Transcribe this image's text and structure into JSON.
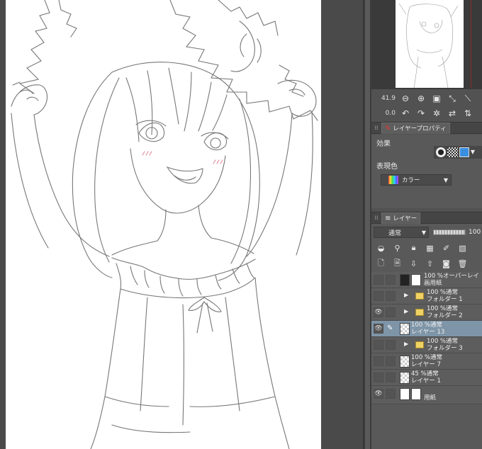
{
  "navigator": {
    "zoom": "41.9",
    "rotation": "0.0"
  },
  "layer_property_panel": {
    "tab_label": "レイヤープロパティ",
    "effect_label": "効果",
    "expression_color_label": "表現色",
    "expression_color_value": "カラー"
  },
  "layer_panel": {
    "tab_label": "レイヤー",
    "blend_mode": "通常",
    "opacity": "100",
    "layers": [
      {
        "line1": "100 %オーバーレイ",
        "line2": "画用紙",
        "type": "image",
        "visible": false,
        "selected": false
      },
      {
        "line1": "100 %通常",
        "line2": "フォルダー 1",
        "type": "folder",
        "visible": false,
        "selected": false
      },
      {
        "line1": "100 %通常",
        "line2": "フォルダー 2",
        "type": "folder",
        "visible": true,
        "selected": false
      },
      {
        "line1": "100 %通常",
        "line2": "レイヤー 13",
        "type": "raster",
        "visible": true,
        "selected": true
      },
      {
        "line1": "100 %通常",
        "line2": "フォルダー 3",
        "type": "folder",
        "visible": false,
        "selected": false
      },
      {
        "line1": "100 %通常",
        "line2": "レイヤー 7",
        "type": "raster",
        "visible": false,
        "selected": false
      },
      {
        "line1": "45 %通常",
        "line2": "レイヤー 1",
        "type": "raster",
        "visible": false,
        "selected": false
      },
      {
        "line1": "",
        "line2": "用紙",
        "type": "paper",
        "visible": true,
        "selected": false
      }
    ]
  },
  "colors": {
    "panel_bg": "#595959",
    "selected_layer": "#7e95a8",
    "canvas_bg": "#4a4a4a",
    "paper": "#ffffff"
  }
}
